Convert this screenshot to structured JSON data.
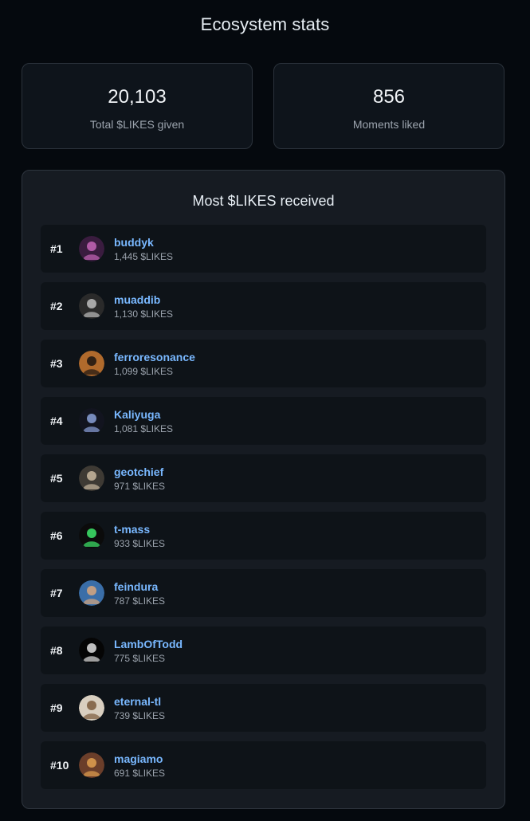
{
  "page": {
    "title": "Ecosystem stats"
  },
  "stats": {
    "total_likes": {
      "value": "20,103",
      "label": "Total $LIKES given"
    },
    "moments_liked": {
      "value": "856",
      "label": "Moments liked"
    }
  },
  "leaderboard": {
    "title": "Most $LIKES received",
    "rows": [
      {
        "rank": "#1",
        "username": "buddyk",
        "likes": "1,445 $LIKES",
        "avatar_colors": [
          "#3a1c3f",
          "#c565b8"
        ]
      },
      {
        "rank": "#2",
        "username": "muaddib",
        "likes": "1,130 $LIKES",
        "avatar_colors": [
          "#2a2a2a",
          "#bdbdbd"
        ]
      },
      {
        "rank": "#3",
        "username": "ferroresonance",
        "likes": "1,099 $LIKES",
        "avatar_colors": [
          "#b06a2c",
          "#1b1410"
        ]
      },
      {
        "rank": "#4",
        "username": "Kaliyuga",
        "likes": "1,081 $LIKES",
        "avatar_colors": [
          "#12141f",
          "#8aa0d8"
        ]
      },
      {
        "rank": "#5",
        "username": "geotchief",
        "likes": "971 $LIKES",
        "avatar_colors": [
          "#3e3a34",
          "#c9b8a0"
        ]
      },
      {
        "rank": "#6",
        "username": "t-mass",
        "likes": "933 $LIKES",
        "avatar_colors": [
          "#0b0b0b",
          "#3ee86b"
        ]
      },
      {
        "rank": "#7",
        "username": "feindura",
        "likes": "787 $LIKES",
        "avatar_colors": [
          "#3a6ea8",
          "#d8a77e"
        ]
      },
      {
        "rank": "#8",
        "username": "LambOfTodd",
        "likes": "775 $LIKES",
        "avatar_colors": [
          "#050505",
          "#e0e0e0"
        ]
      },
      {
        "rank": "#9",
        "username": "eternal-tl",
        "likes": "739 $LIKES",
        "avatar_colors": [
          "#d9cfc0",
          "#7a5a3c"
        ]
      },
      {
        "rank": "#10",
        "username": "magiamo",
        "likes": "691 $LIKES",
        "avatar_colors": [
          "#6b3e2a",
          "#e0a050"
        ]
      }
    ]
  }
}
